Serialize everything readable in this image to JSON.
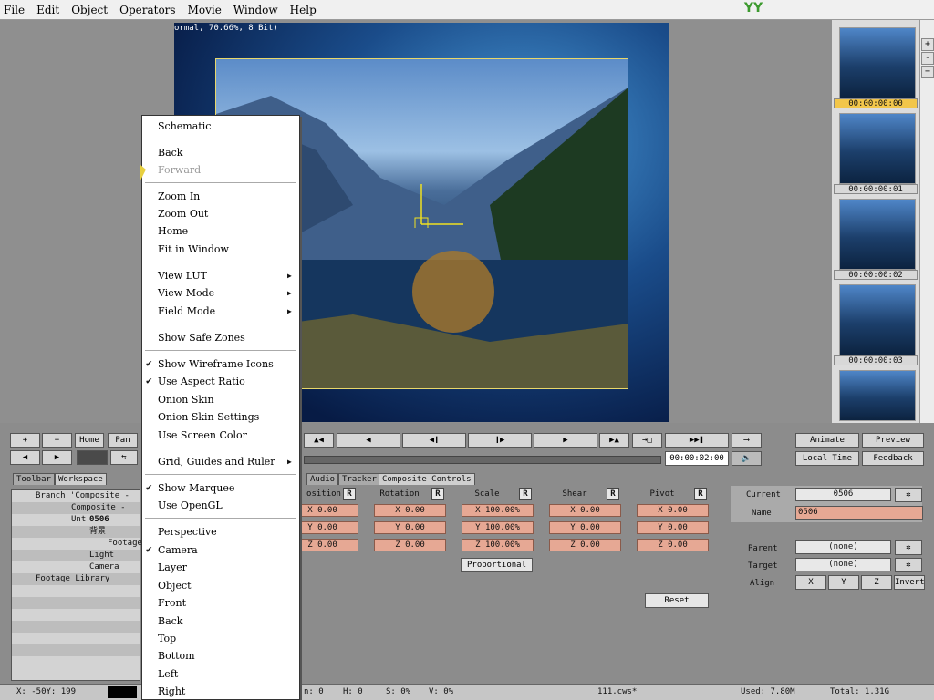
{
  "menubar": [
    "File",
    "Edit",
    "Object",
    "Operators",
    "Movie",
    "Window",
    "Help"
  ],
  "viewer_status": "ormal, 70.66%, 8 Bit)",
  "timecodes": [
    "00:00:00:00",
    "00:00:00:01",
    "00:00:00:02",
    "00:00:00:03"
  ],
  "scroll_buttons": [
    "+",
    "-",
    "−"
  ],
  "toolbar_left": [
    "+",
    "−",
    "Home",
    "Pan"
  ],
  "transport_time": "00:00:02:00",
  "animate_label": "Animate",
  "preview_label": "Preview",
  "localtime_label": "Local Time",
  "feedback_label": "Feedback",
  "tabs_left": [
    "Toolbar",
    "Workspace"
  ],
  "tabs_main": [
    "Audio",
    "Tracker",
    "Composite Controls"
  ],
  "tree_items": [
    "Branch 'Composite - Unt",
    "Composite - Unt",
    "0506",
    "背景",
    "Footage",
    "Light",
    "Camera",
    "Footage Library"
  ],
  "param_headers": [
    "osition",
    "Rotation",
    "Scale",
    "Shear",
    "Pivot"
  ],
  "param_rows": [
    [
      "X 0.00",
      "X 0.00",
      "X 100.00%",
      "X 0.00",
      "X 0.00"
    ],
    [
      "Y 0.00",
      "Y 0.00",
      "Y 100.00%",
      "Y 0.00",
      "Y 0.00"
    ],
    [
      "Z 0.00",
      "Z 0.00",
      "Z 100.00%",
      "Z 0.00",
      "Z 0.00"
    ]
  ],
  "proportional_label": "Proportional",
  "reset_label": "Reset",
  "right_panel": {
    "current_label": "Current",
    "current_value": "0506",
    "name_label": "Name",
    "name_value": "0506",
    "parent_label": "Parent",
    "parent_value": "(none)",
    "target_label": "Target",
    "target_value": "(none)",
    "align_label": "Align",
    "align_x": "X",
    "align_y": "Y",
    "align_z": "Z",
    "invert": "Invert"
  },
  "statusbar": {
    "x": "X:   -50Y:  199",
    "h": "H: 0",
    "s": "S: 0%",
    "v": "V: 0%",
    "file": "111.cws*",
    "used": "Used: 7.80M",
    "total": "Total: 1.31G",
    "n": "n: 0"
  },
  "context_menu": [
    "Schematic",
    "Back",
    "Forward",
    "Zoom In",
    "Zoom Out",
    "Home",
    "Fit in Window",
    "View LUT",
    "View Mode",
    "Field Mode",
    "Show Safe Zones",
    "Show Wireframe Icons",
    "Use Aspect Ratio",
    "Onion Skin",
    "Onion Skin Settings",
    "Use Screen Color",
    "Grid, Guides and Ruler",
    "Show Marquee",
    "Use OpenGL",
    "Perspective",
    "Camera",
    "Layer",
    "Object",
    "Front",
    "Back",
    "Top",
    "Bottom",
    "Left",
    "Right"
  ],
  "logo_text": "YY"
}
